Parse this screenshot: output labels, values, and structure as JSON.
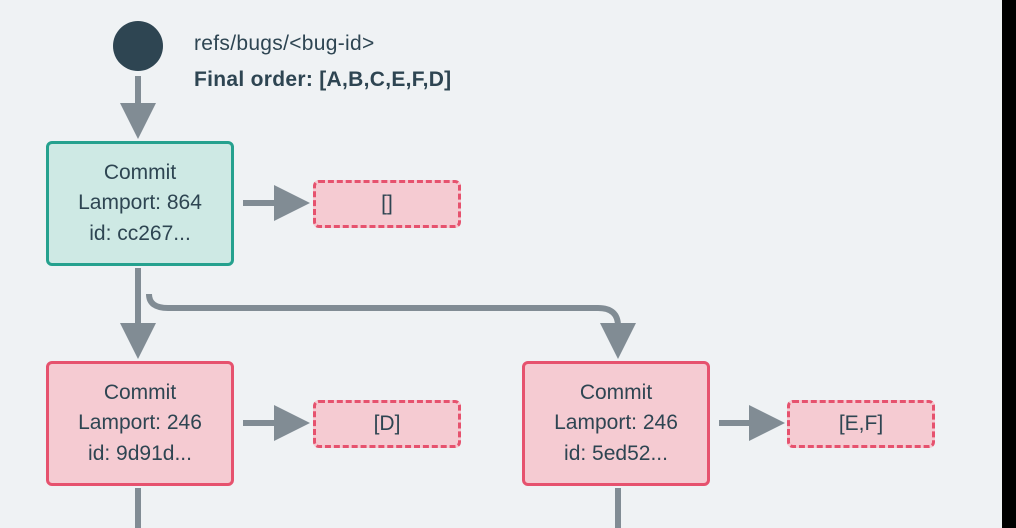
{
  "header": {
    "ref_path": "refs/bugs/<bug-id>",
    "final_order_label": "Final order: [A,B,C,E,F,D]"
  },
  "commits": {
    "top": {
      "title": "Commit",
      "lamport": "Lamport: 864",
      "id": "id: cc267...",
      "ops": "[]"
    },
    "left": {
      "title": "Commit",
      "lamport": "Lamport: 246",
      "id": "id: 9d91d...",
      "ops": "[D]"
    },
    "right": {
      "title": "Commit",
      "lamport": "Lamport: 246",
      "id": "id: 5ed52...",
      "ops": "[E,F]"
    }
  },
  "colors": {
    "node_fill_teal": "#cee9e4",
    "node_border_teal": "#25a18e",
    "node_fill_red": "#f5cbd2",
    "node_border_red": "#e6526e",
    "text": "#2e4552",
    "arrow": "#818c94",
    "bg": "#eff2f4"
  }
}
